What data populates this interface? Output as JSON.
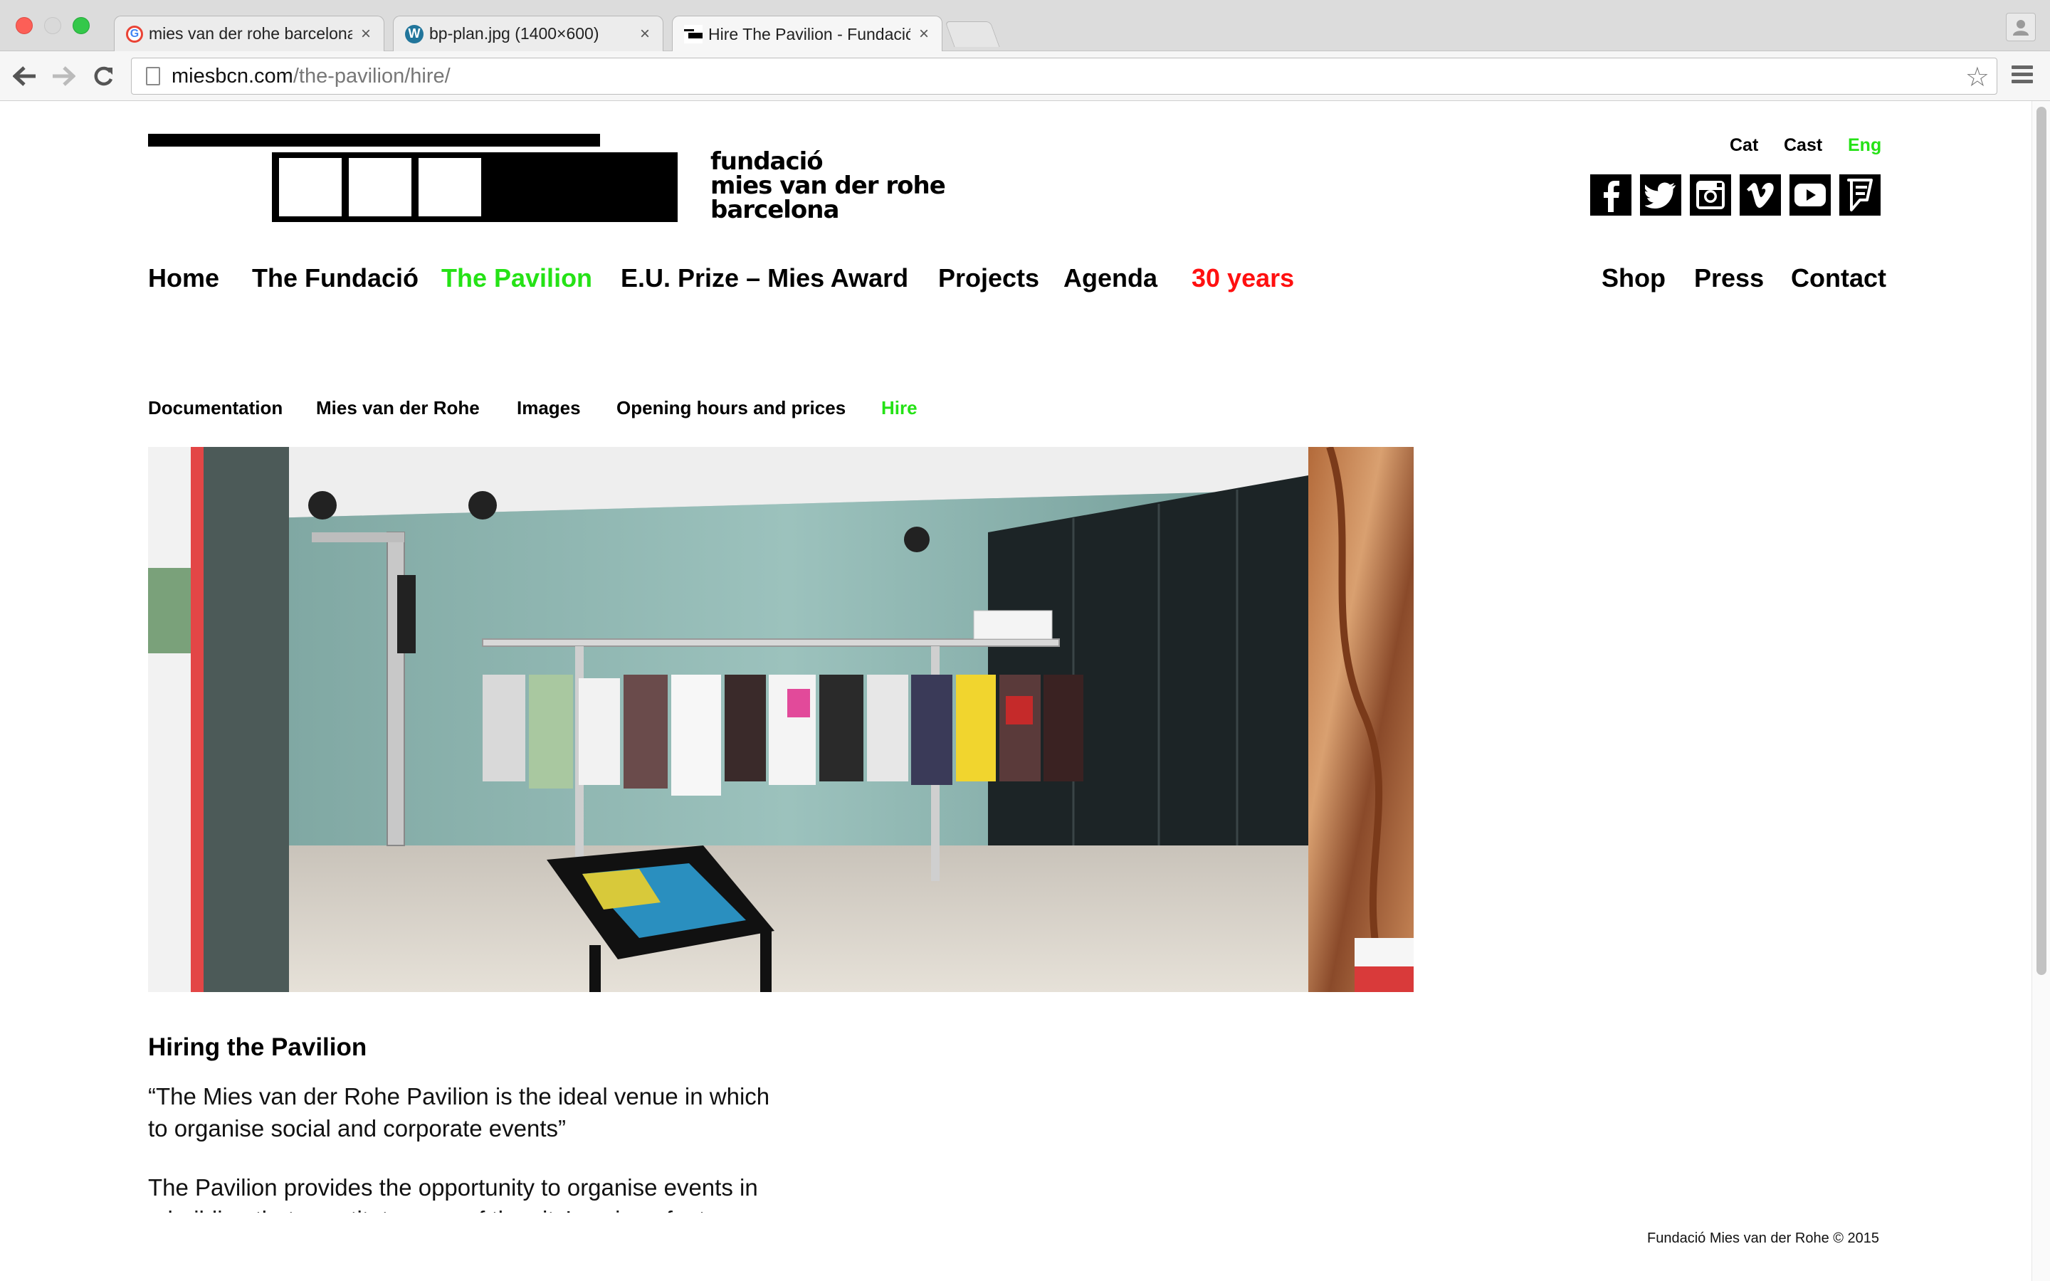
{
  "browser": {
    "tabs": [
      {
        "title": "mies van der rohe barcelona",
        "favicon": "google-icon",
        "active": false
      },
      {
        "title": "bp-plan.jpg (1400×600)",
        "favicon": "wordpress-icon",
        "active": false
      },
      {
        "title": "Hire The Pavilion - Fundació",
        "favicon": "fundacio-icon",
        "active": true
      }
    ],
    "close_glyph": "×",
    "url_domain": "miesbcn.com",
    "url_path": "/the-pavilion/hire/"
  },
  "logo": {
    "line1": "fundació",
    "line2": "mies van der rohe",
    "line3": "barcelona"
  },
  "languages": [
    {
      "label": "Cat",
      "active": false
    },
    {
      "label": "Cast",
      "active": false
    },
    {
      "label": "Eng",
      "active": true
    }
  ],
  "social": [
    "facebook-icon",
    "twitter-icon",
    "instagram-icon",
    "vimeo-icon",
    "youtube-icon",
    "foursquare-icon"
  ],
  "main_nav": [
    {
      "label": "Home",
      "state": "normal"
    },
    {
      "label": "The Fundació",
      "state": "normal"
    },
    {
      "label": "The Pavilion",
      "state": "active"
    },
    {
      "label": "E.U. Prize – Mies Award",
      "state": "normal"
    },
    {
      "label": "Projects",
      "state": "normal"
    },
    {
      "label": "Agenda",
      "state": "normal"
    },
    {
      "label": "30 years",
      "state": "highlight"
    }
  ],
  "right_nav": [
    {
      "label": "Shop"
    },
    {
      "label": "Press"
    },
    {
      "label": "Contact"
    }
  ],
  "sub_nav": [
    {
      "label": "Documentation",
      "active": false
    },
    {
      "label": "Mies van der Rohe",
      "active": false
    },
    {
      "label": "Images",
      "active": false
    },
    {
      "label": "Opening hours and prices",
      "active": false
    },
    {
      "label": "Hire",
      "active": true
    }
  ],
  "content": {
    "title": "Hiring the Pavilion",
    "quote": "“The Mies van der Rohe Pavilion is the ideal venue in which to organise social and corporate events”",
    "paragraph": "The Pavilion provides the opportunity to organise events in a building that constitutes one of the city’s unique features..."
  },
  "footer": "Fundació Mies van der Rohe © 2015",
  "colors": {
    "active_green": "#25e216",
    "highlight_red": "#ff1010"
  }
}
